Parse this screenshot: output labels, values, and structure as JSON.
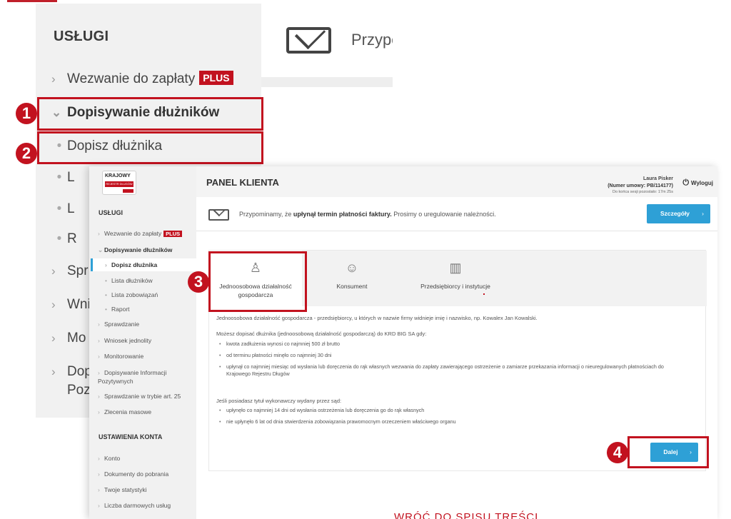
{
  "zoomed": {
    "section_heading": "USŁUGI",
    "items": {
      "wezwanie": "Wezwanie do zapłaty",
      "plus_badge": "PLUS",
      "dopisywanie": "Dopisywanie dłużników",
      "dopisz": "Dopisz dłużnika",
      "cut_l1": "L",
      "cut_l2": "L",
      "cut_r": "R",
      "cut_spr": "Spr",
      "cut_wni": "Wni",
      "cut_mo": "Mo",
      "cut_dop": "Dop",
      "cut_poz": "Poz"
    },
    "reminder_cut": "Przypo"
  },
  "steps": [
    "1",
    "2",
    "3",
    "4"
  ],
  "logo": {
    "line1": "KRAJOWY",
    "line2": "REJESTR DŁUGÓW"
  },
  "sidebar": {
    "heading_services": "USŁUGI",
    "services": [
      "Wezwanie do zapłaty",
      "Dopisywanie dłużników",
      "Dopisz dłużnika",
      "Lista dłużników",
      "Lista zobowiązań",
      "Raport",
      "Sprawdzanie",
      "Wniosek jednolity",
      "Monitorowanie",
      "Dopisywanie Informacji Pozytywnych",
      "Sprawdzanie w trybie art. 25",
      "Zlecenia masowe"
    ],
    "plus_badge": "PLUS",
    "heading_account": "USTAWIENIA KONTA",
    "account": [
      "Konto",
      "Dokumenty do pobrania",
      "Twoje statystyki",
      "Liczba darmowych usług"
    ]
  },
  "header": {
    "title": "PANEL KLIENTA",
    "user_name": "Laura Pisker",
    "contract": "(Numer umowy: PB/114177)",
    "session": "Do końca sesji pozostało: 17m 25s",
    "logout": "Wyloguj"
  },
  "notice": {
    "prefix": "Przypominamy, że ",
    "bold": "upłynął termin płatności faktury.",
    "suffix": " Prosimy o uregulowanie należności.",
    "button": "Szczegóły"
  },
  "tabs": [
    {
      "label": "Jednoosobowa działalność gospodarcza",
      "icon": "person-tie-icon"
    },
    {
      "label": "Konsument",
      "icon": "person-icon"
    },
    {
      "label": "Przedsiębiorcy i instytucje",
      "icon": "buildings-icon"
    }
  ],
  "content": {
    "intro": "Jednoosobowa działalność gospodarcza - przedsiębiorcy, u których w nazwie firmy widnieje imię i nazwisko, np. Kowalex Jan Kowalski.",
    "cond_heading": "Możesz dopisać dłużnika (jednoosobową działalność gospodarczą) do KRD BIG SA gdy:",
    "conditions": [
      "kwota zadłużenia wynosi co najmniej 500 zł brutto",
      "od terminu płatności minęło co najmniej 30 dni",
      "upłynął co najmniej miesiąc od wysłania lub doręczenia do rąk własnych wezwania do zapłaty zawierającego ostrzeżenie o zamiarze przekazania informacji o nieuregulowanych płatnościach do Krajowego Rejestru Długów"
    ],
    "title_heading": "Jeśli posiadasz tytuł wykonawczy wydany przez sąd:",
    "title_conditions": [
      "upłynęło co najmniej 14 dni od wysłania ostrzeżenia lub doręczenia go do rąk własnych",
      "nie upłynęło 6 lat od dnia stwierdzenia zobowiązania prawomocnym orzeczeniem właściwego organu"
    ],
    "next_button": "Dalej"
  },
  "footer_cut": "WRÓĆ DO SPISU TREŚCI",
  "colors": {
    "brand_red": "#c2121f",
    "accent_blue": "#2ea0d6"
  }
}
